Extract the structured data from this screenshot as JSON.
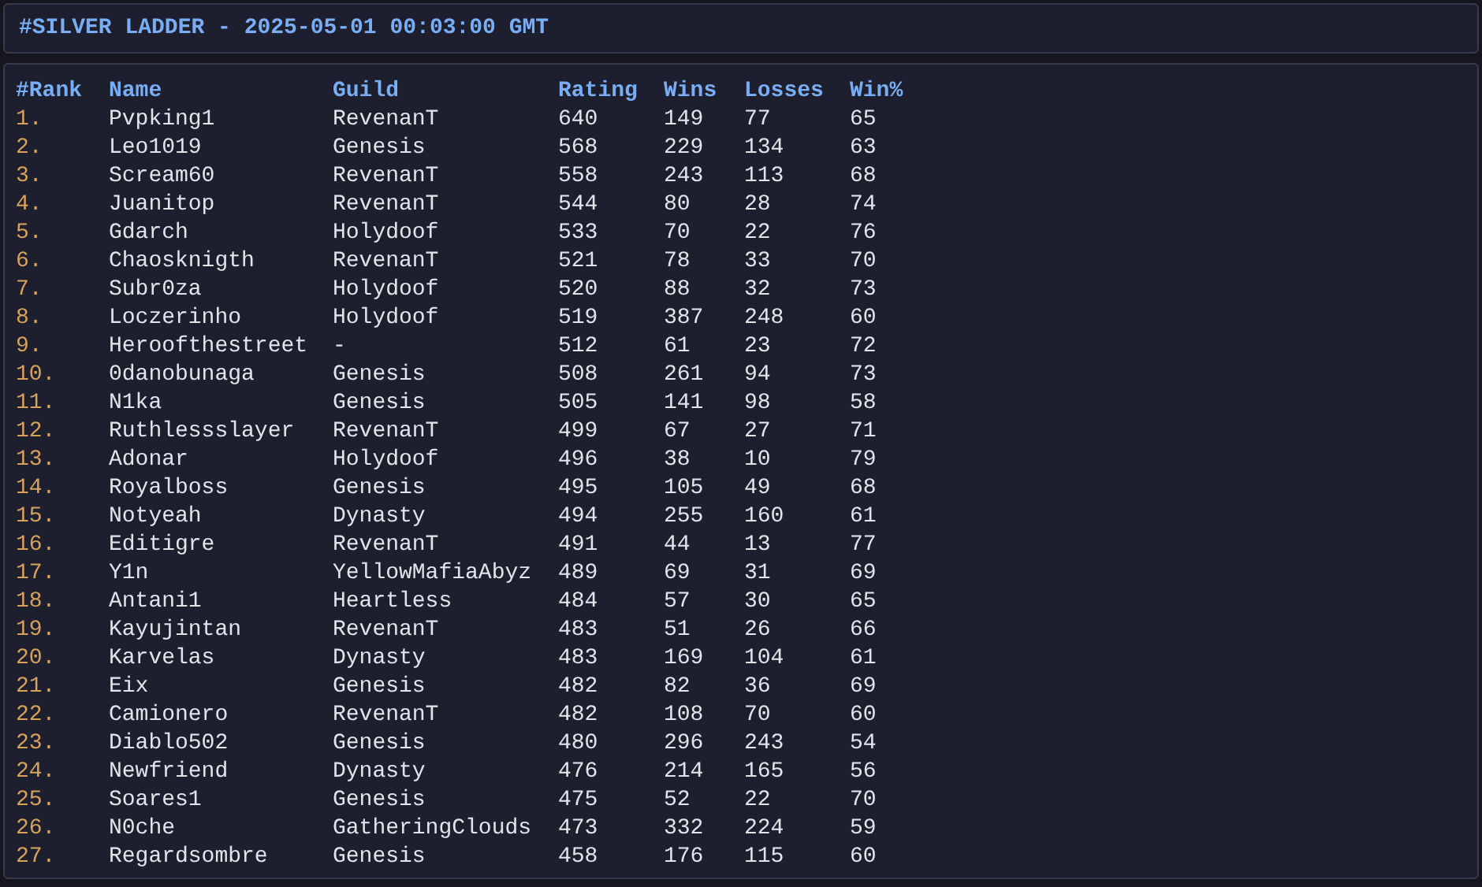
{
  "title": "#SILVER LADDER - 2025-05-01 00:03:00 GMT",
  "table": {
    "columns": [
      "#Rank",
      "Name",
      "Guild",
      "Rating",
      "Wins",
      "Losses",
      "Win%"
    ],
    "rows": [
      [
        "1.",
        "Pvpking1",
        "RevenanT",
        "640",
        "149",
        "77",
        "65"
      ],
      [
        "2.",
        "Leo1019",
        "Genesis",
        "568",
        "229",
        "134",
        "63"
      ],
      [
        "3.",
        "Scream60",
        "RevenanT",
        "558",
        "243",
        "113",
        "68"
      ],
      [
        "4.",
        "Juanitop",
        "RevenanT",
        "544",
        "80",
        "28",
        "74"
      ],
      [
        "5.",
        "Gdarch",
        "Holydoof",
        "533",
        "70",
        "22",
        "76"
      ],
      [
        "6.",
        "Chaosknigth",
        "RevenanT",
        "521",
        "78",
        "33",
        "70"
      ],
      [
        "7.",
        "Subr0za",
        "Holydoof",
        "520",
        "88",
        "32",
        "73"
      ],
      [
        "8.",
        "Loczerinho",
        "Holydoof",
        "519",
        "387",
        "248",
        "60"
      ],
      [
        "9.",
        "Heroofthestreet",
        "-",
        "512",
        "61",
        "23",
        "72"
      ],
      [
        "10.",
        "0danobunaga",
        "Genesis",
        "508",
        "261",
        "94",
        "73"
      ],
      [
        "11.",
        "N1ka",
        "Genesis",
        "505",
        "141",
        "98",
        "58"
      ],
      [
        "12.",
        "Ruthlessslayer",
        "RevenanT",
        "499",
        "67",
        "27",
        "71"
      ],
      [
        "13.",
        "Adonar",
        "Holydoof",
        "496",
        "38",
        "10",
        "79"
      ],
      [
        "14.",
        "Royalboss",
        "Genesis",
        "495",
        "105",
        "49",
        "68"
      ],
      [
        "15.",
        "Notyeah",
        "Dynasty",
        "494",
        "255",
        "160",
        "61"
      ],
      [
        "16.",
        "Editigre",
        "RevenanT",
        "491",
        "44",
        "13",
        "77"
      ],
      [
        "17.",
        "Y1n",
        "YellowMafiaAbyz",
        "489",
        "69",
        "31",
        "69"
      ],
      [
        "18.",
        "Antani1",
        "Heartless",
        "484",
        "57",
        "30",
        "65"
      ],
      [
        "19.",
        "Kayujintan",
        "RevenanT",
        "483",
        "51",
        "26",
        "66"
      ],
      [
        "20.",
        "Karvelas",
        "Dynasty",
        "483",
        "169",
        "104",
        "61"
      ],
      [
        "21.",
        "Eix",
        "Genesis",
        "482",
        "82",
        "36",
        "69"
      ],
      [
        "22.",
        "Camionero",
        "RevenanT",
        "482",
        "108",
        "70",
        "60"
      ],
      [
        "23.",
        "Diablo502",
        "Genesis",
        "480",
        "296",
        "243",
        "54"
      ],
      [
        "24.",
        "Newfriend",
        "Dynasty",
        "476",
        "214",
        "165",
        "56"
      ],
      [
        "25.",
        "Soares1",
        "Genesis",
        "475",
        "52",
        "22",
        "70"
      ],
      [
        "26.",
        "N0che",
        "GatheringClouds",
        "473",
        "332",
        "224",
        "59"
      ],
      [
        "27.",
        "Regardsombre",
        "Genesis",
        "458",
        "176",
        "115",
        "60"
      ]
    ]
  }
}
